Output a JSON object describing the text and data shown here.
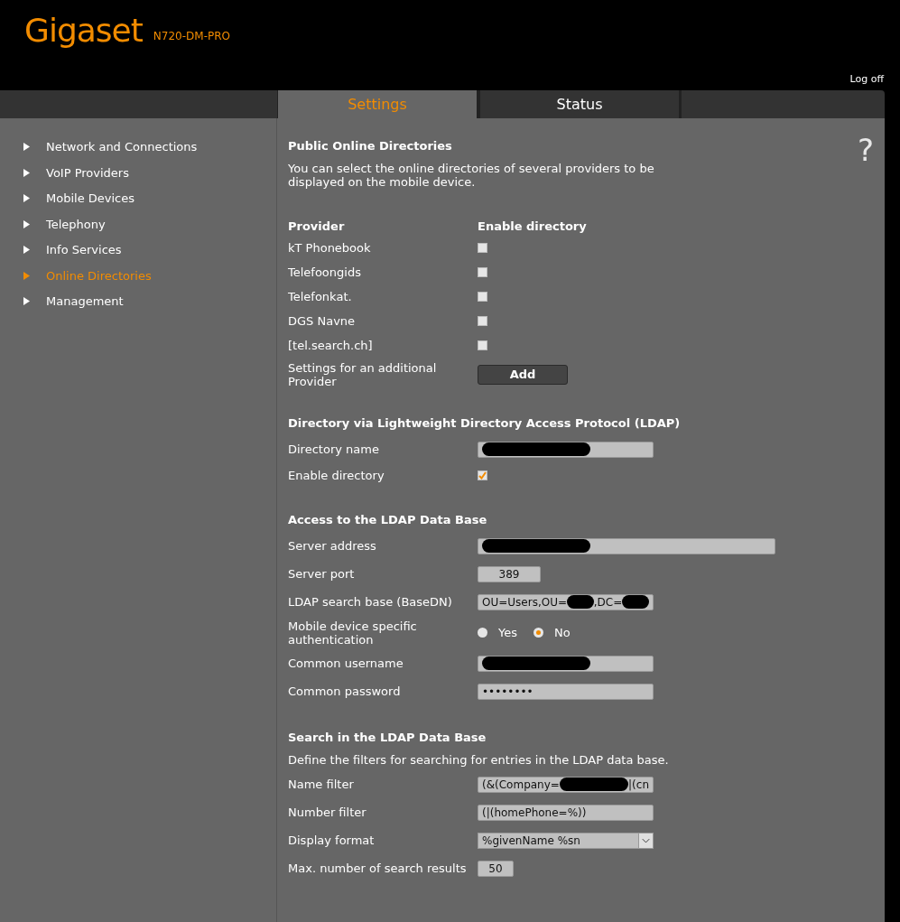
{
  "header": {
    "logo": "Gigaset",
    "model": "N720-DM-PRO",
    "logoff": "Log off"
  },
  "tabs": [
    {
      "label": "Settings",
      "selected": true
    },
    {
      "label": "Status",
      "selected": false
    }
  ],
  "sidebar": {
    "items": [
      {
        "label": "Network and Connections",
        "selected": false
      },
      {
        "label": "VoIP Providers",
        "selected": false
      },
      {
        "label": "Mobile Devices",
        "selected": false
      },
      {
        "label": "Telephony",
        "selected": false
      },
      {
        "label": "Info Services",
        "selected": false
      },
      {
        "label": "Online Directories",
        "selected": true
      },
      {
        "label": "Management",
        "selected": false
      }
    ]
  },
  "help": "?",
  "sections": [
    {
      "title": "Public Online Directories",
      "description": "You can select the online directories of several providers to be displayed on the mobile device.",
      "columns": [
        "Provider",
        "Enable directory"
      ],
      "rows": [
        {
          "kind": "checkbox",
          "label": "kT Phonebook",
          "checked": false
        },
        {
          "kind": "checkbox",
          "label": "Telefoongids",
          "checked": false
        },
        {
          "kind": "checkbox",
          "label": "Telefonkat.",
          "checked": false
        },
        {
          "kind": "checkbox",
          "label": "DGS Navne",
          "checked": false
        },
        {
          "kind": "checkbox",
          "label": "[tel.search.ch]",
          "checked": false
        },
        {
          "kind": "button",
          "label": "Settings for an additional Provider",
          "button": "Add"
        }
      ]
    },
    {
      "title": "Directory via Lightweight Directory Access Protocol (LDAP)",
      "rows": [
        {
          "kind": "text",
          "label": "Directory name",
          "value": [
            {
              "kind": "redacted"
            }
          ]
        },
        {
          "kind": "checkbox",
          "label": "Enable directory",
          "checked": true
        }
      ]
    },
    {
      "title": "Access to the LDAP Data Base",
      "rows": [
        {
          "kind": "long-text",
          "label": "Server address",
          "value": [
            {
              "kind": "redacted"
            }
          ]
        },
        {
          "kind": "port",
          "label": "Server port",
          "value": [
            {
              "kind": "text",
              "text": "389"
            }
          ]
        },
        {
          "kind": "text",
          "label": "LDAP search base (BaseDN)",
          "value": [
            {
              "kind": "text",
              "text": "OU=Users,OU="
            },
            {
              "kind": "redacted"
            },
            {
              "kind": "text",
              "text": ",DC="
            },
            {
              "kind": "redacted"
            }
          ]
        },
        {
          "kind": "radio",
          "label": "Mobile device specific authentication",
          "options": [
            {
              "label": "Yes",
              "selected": false
            },
            {
              "label": "No",
              "selected": true
            }
          ]
        },
        {
          "kind": "text",
          "label": "Common username",
          "value": [
            {
              "kind": "redacted"
            }
          ]
        },
        {
          "kind": "text",
          "label": "Common password",
          "value": [
            {
              "kind": "text",
              "text": "••••••••"
            }
          ]
        }
      ]
    },
    {
      "title": "Search in the LDAP Data Base",
      "description": "Define the filters for searching for entries in the LDAP data base.",
      "rows": [
        {
          "kind": "text",
          "label": "Name filter",
          "value": [
            {
              "kind": "text",
              "text": "(&(Company="
            },
            {
              "kind": "redacted"
            },
            {
              "kind": "text",
              "text": "|(cn"
            }
          ]
        },
        {
          "kind": "text",
          "label": "Number filter",
          "value": [
            {
              "kind": "text",
              "text": "(|(homePhone=%))"
            }
          ]
        },
        {
          "kind": "select",
          "label": "Display format",
          "value": [
            {
              "kind": "text",
              "text": "%givenName %sn"
            }
          ]
        },
        {
          "kind": "count",
          "label": "Max. number of search results",
          "value": [
            {
              "kind": "text",
              "text": "50"
            }
          ]
        }
      ]
    }
  ]
}
